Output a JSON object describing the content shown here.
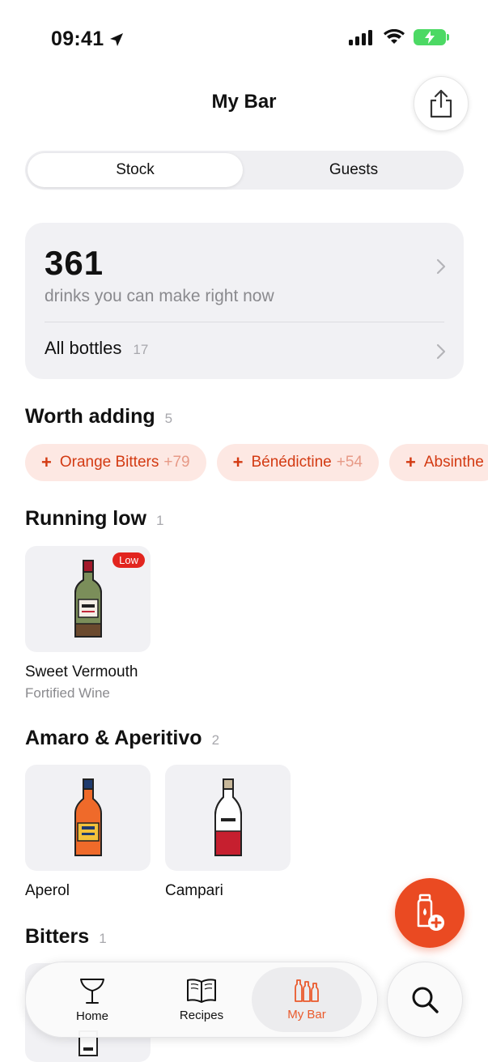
{
  "status": {
    "time": "09:41"
  },
  "header": {
    "title": "My Bar",
    "share_icon": "share-icon"
  },
  "segments": {
    "stock": "Stock",
    "guests": "Guests",
    "selected": "Stock"
  },
  "summary": {
    "count": "361",
    "caption": "drinks you can make right now",
    "all_bottles_label": "All bottles",
    "all_bottles_count": "17"
  },
  "worth_adding": {
    "title": "Worth adding",
    "count": "5",
    "chips": [
      {
        "label": "Orange Bitters",
        "boost": "+79"
      },
      {
        "label": "Bénédictine",
        "boost": "+54"
      },
      {
        "label": "Absinthe",
        "boost": ""
      }
    ]
  },
  "running_low": {
    "title": "Running low",
    "count": "1",
    "items": [
      {
        "name": "Sweet Vermouth",
        "category": "Fortified Wine",
        "badge": "Low"
      }
    ]
  },
  "amaro": {
    "title": "Amaro & Aperitivo",
    "count": "2",
    "items": [
      {
        "name": "Aperol"
      },
      {
        "name": "Campari"
      }
    ]
  },
  "bitters": {
    "title": "Bitters",
    "count": "1"
  },
  "tabbar": {
    "home": "Home",
    "recipes": "Recipes",
    "mybar": "My Bar",
    "active": "My Bar"
  },
  "colors": {
    "accent": "#ea4a22",
    "chip_bg": "#fde8e3",
    "chip_text": "#d33a12",
    "low_badge": "#e2251f",
    "battery": "#4cd964"
  }
}
